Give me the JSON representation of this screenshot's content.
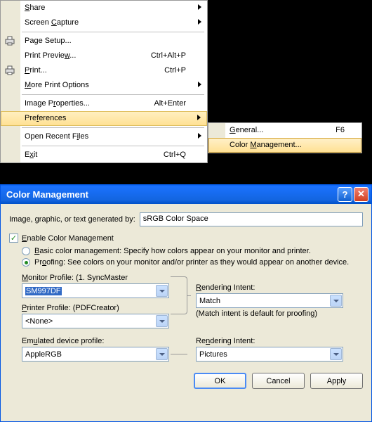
{
  "menu": {
    "share": "Share",
    "screen_capture": "Screen Capture",
    "page_setup": "Page Setup...",
    "print_preview": "Print Preview...",
    "print_preview_sc": "Ctrl+Alt+P",
    "print": "Print...",
    "print_sc": "Ctrl+P",
    "more_print": "More Print Options",
    "img_props": "Image Properties...",
    "img_props_sc": "Alt+Enter",
    "preferences": "Preferences",
    "open_recent": "Open Recent Files",
    "exit": "Exit",
    "exit_sc": "Ctrl+Q"
  },
  "submenu": {
    "general": "General...",
    "general_sc": "F6",
    "color_mgmt": "Color Management..."
  },
  "dialog": {
    "title": "Color Management",
    "gen_by": "Image, graphic, or text generated by:",
    "gen_by_val": "sRGB Color Space",
    "enable": "Enable Color Management",
    "basic": "Basic color management: Specify how colors appear on your monitor and printer.",
    "proofing": "Proofing: See colors on your monitor and/or printer as they would appear on another device.",
    "monitor_profile": "Monitor Profile: (1. SyncMaster",
    "monitor_val": "SM997DF",
    "printer_profile": "Printer Profile: (PDFCreator)",
    "printer_val": "<None>",
    "rendering1": "Rendering Intent:",
    "rendering1_val": "Match",
    "rendering1_hint": "(Match intent is default for proofing)",
    "emulated": "Emulated device profile:",
    "emulated_val": "AppleRGB",
    "rendering2": "Rendering Intent:",
    "rendering2_val": "Pictures",
    "ok": "OK",
    "cancel": "Cancel",
    "apply": "Apply"
  }
}
